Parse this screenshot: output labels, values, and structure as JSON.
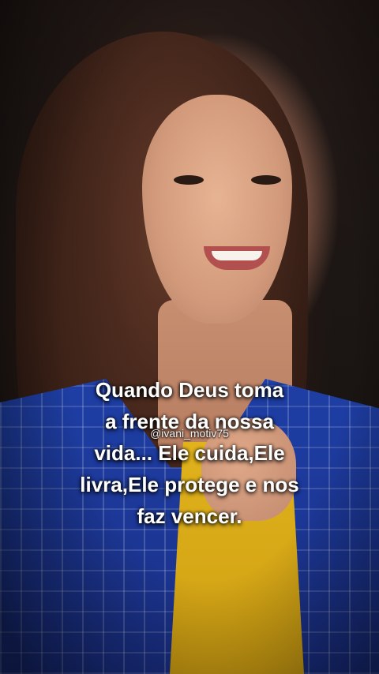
{
  "quote": {
    "lines": [
      "Quando Deus toma",
      "a frente da nossa",
      "vida... Ele cuida,Ele",
      "livra,Ele protege e nos",
      "faz vencer."
    ]
  },
  "watermark": {
    "handle": "@ivani_motiv75"
  }
}
